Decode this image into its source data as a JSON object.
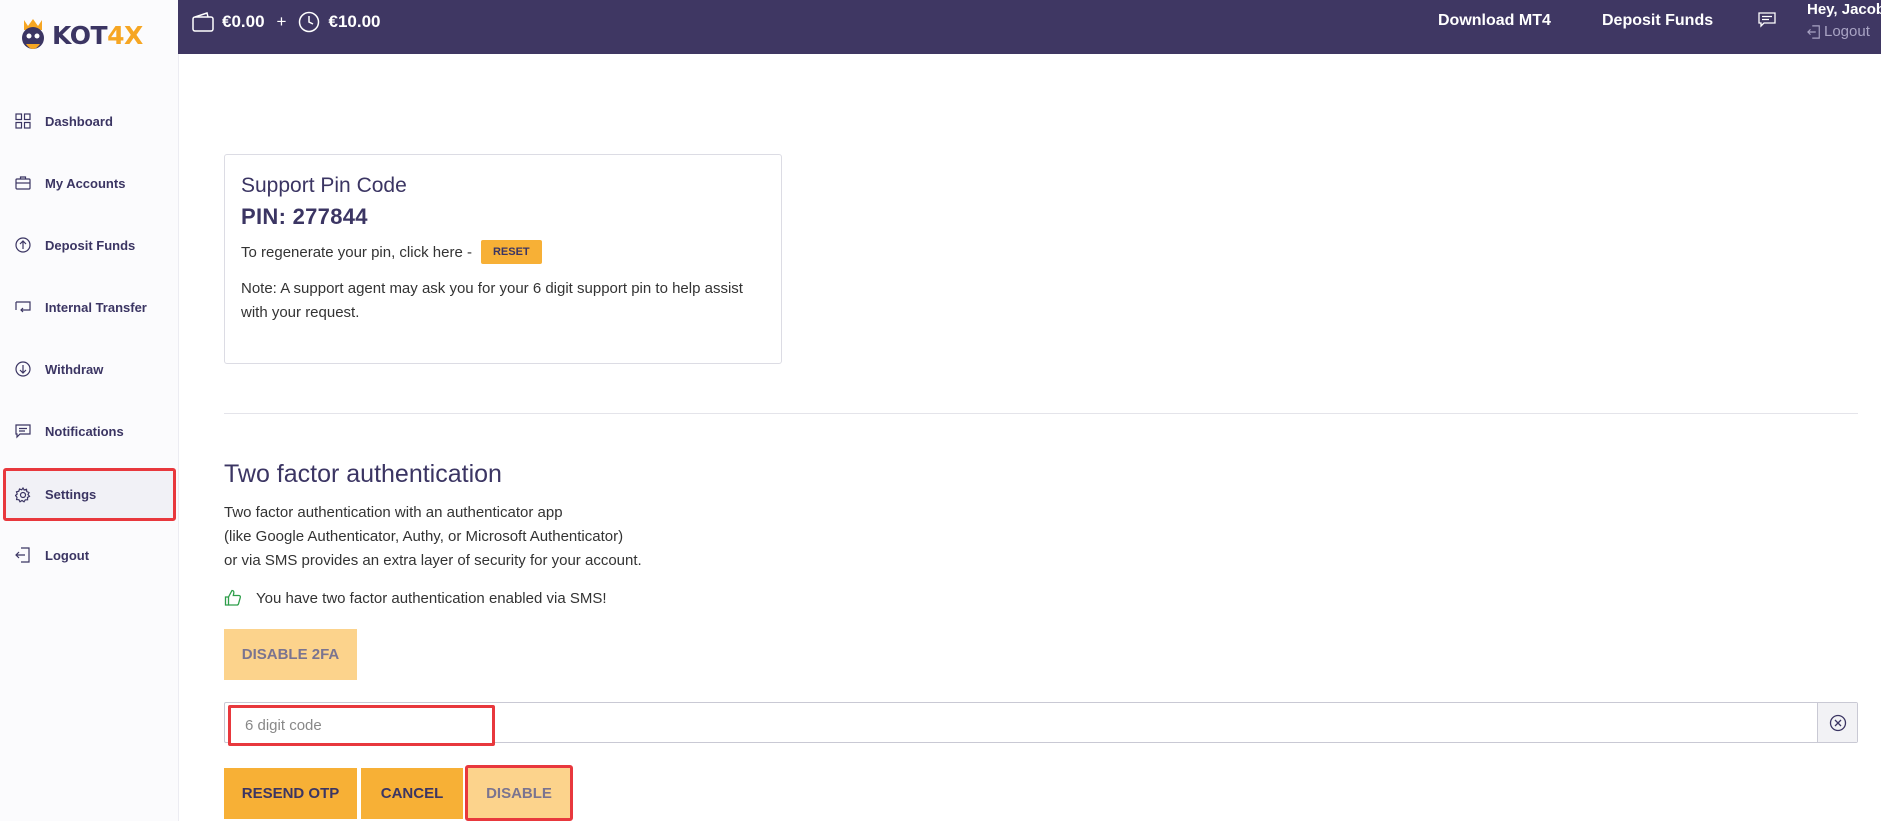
{
  "brand": {
    "name_main": "KOT",
    "name_accent": "4X"
  },
  "sidebar": {
    "items": [
      {
        "label": "Dashboard",
        "icon": "grid-icon"
      },
      {
        "label": "My Accounts",
        "icon": "briefcase-icon"
      },
      {
        "label": "Deposit Funds",
        "icon": "arrow-up-circle-icon"
      },
      {
        "label": "Internal Transfer",
        "icon": "transfer-icon"
      },
      {
        "label": "Withdraw",
        "icon": "arrow-down-circle-icon"
      },
      {
        "label": "Notifications",
        "icon": "message-icon"
      },
      {
        "label": "Settings",
        "icon": "gear-icon"
      },
      {
        "label": "Logout",
        "icon": "logout-icon"
      }
    ]
  },
  "topbar": {
    "wallet_balance": "€0.00",
    "plus": "+",
    "pending_balance": "€10.00",
    "download_label": "Download MT4",
    "deposit_label": "Deposit Funds",
    "greeting": "Hey, Jacob",
    "logout_label": "Logout"
  },
  "support_pin": {
    "title": "Support Pin Code",
    "pin_text": "PIN: 277844",
    "regen_text": "To regenerate your pin, click here -",
    "reset_label": "RESET",
    "note": "Note: A support agent may ask you for your 6 digit support pin to help assist with your request."
  },
  "two_factor": {
    "title": "Two factor authentication",
    "desc_line1": "Two factor authentication with an authenticator app",
    "desc_line2": "(like Google Authenticator, Authy, or Microsoft Authenticator)",
    "desc_line3": "or via SMS provides an extra layer of security for your account.",
    "status": "You have two factor authentication enabled via SMS!",
    "disable_2fa_label": "DISABLE 2FA",
    "code_placeholder": "6 digit code",
    "code_value": "",
    "resend_label": "RESEND OTP",
    "cancel_label": "CANCEL",
    "disable_label": "DISABLE"
  },
  "colors": {
    "topbar": "#3f3763",
    "accent": "#f7b036",
    "accent_disabled": "#fcd38c",
    "highlight": "#e8383d",
    "text": "#3b3563"
  }
}
